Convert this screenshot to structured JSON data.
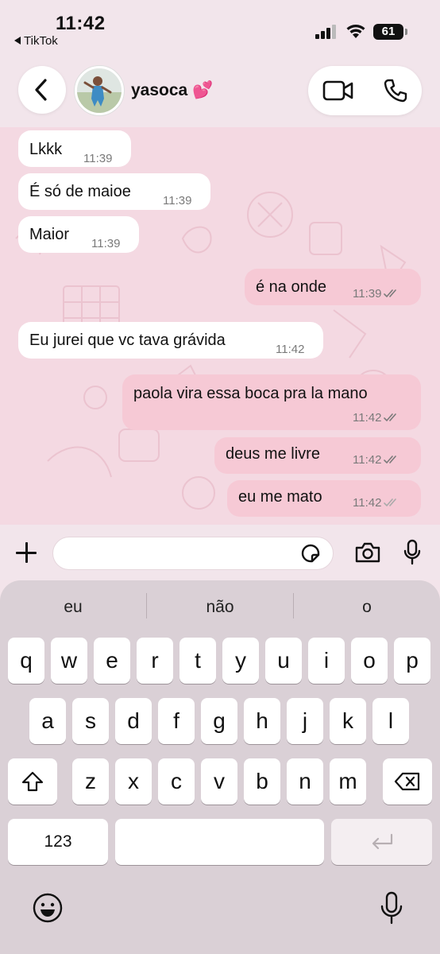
{
  "status_bar": {
    "time": "11:42",
    "back_app": "TikTok",
    "battery": "61"
  },
  "header": {
    "contact_name": "yasoca 💕"
  },
  "messages": [
    {
      "dir": "in",
      "text": "Lkkk",
      "time": "11:39"
    },
    {
      "dir": "in",
      "text": "É só de maioe",
      "time": "11:39"
    },
    {
      "dir": "in",
      "text": "Maior",
      "time": "11:39"
    },
    {
      "dir": "out",
      "text": "é na onde",
      "time": "11:39"
    },
    {
      "dir": "in",
      "text": "Eu jurei que vc tava grávida",
      "time": "11:42"
    },
    {
      "dir": "out",
      "text": "paola vira essa boca pra la mano",
      "time": "11:42"
    },
    {
      "dir": "out",
      "text": "deus me livre",
      "time": "11:42"
    },
    {
      "dir": "out",
      "text": "eu me mato",
      "time": "11:42"
    }
  ],
  "input": {
    "placeholder": ""
  },
  "keyboard": {
    "suggestions": [
      "eu",
      "não",
      "o"
    ],
    "row1": [
      "q",
      "w",
      "e",
      "r",
      "t",
      "y",
      "u",
      "i",
      "o",
      "p"
    ],
    "row2": [
      "a",
      "s",
      "d",
      "f",
      "g",
      "h",
      "j",
      "k",
      "l"
    ],
    "row3": [
      "z",
      "x",
      "c",
      "v",
      "b",
      "n",
      "m"
    ],
    "numbers_key": "123"
  },
  "colors": {
    "incoming": "#ffffff",
    "outgoing": "#f6c9d5",
    "chat_bg": "#f4d9e2",
    "read_ticks": "#7a7a7a"
  },
  "icons": [
    "back-chevron-icon",
    "video-call-icon",
    "phone-icon",
    "plus-icon",
    "sticker-icon",
    "camera-icon",
    "mic-icon",
    "shift-icon",
    "backspace-icon",
    "return-icon",
    "emoji-icon"
  ]
}
